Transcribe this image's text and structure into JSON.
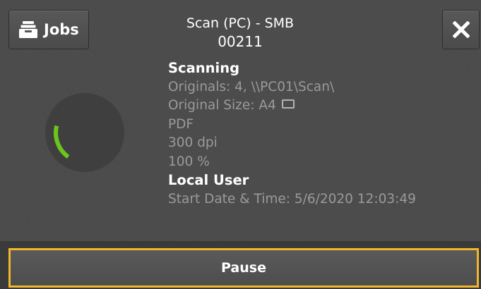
{
  "header": {
    "jobs_label": "Jobs",
    "title": "Scan (PC) - SMB",
    "job_number": "00211"
  },
  "status": {
    "state": "Scanning",
    "originals": "Originals: 4, \\\\PC01\\Scan\\",
    "original_size": "Original Size: A4",
    "file_format": "PDF",
    "resolution": "300 dpi",
    "scale": "100 %",
    "user": "Local User",
    "start_datetime": "Start Date & Time: 5/6/2020 12:03:49"
  },
  "footer": {
    "pause_label": "Pause"
  },
  "icons": {
    "jobs": "jobs-tray-icon",
    "close": "close-icon",
    "orientation": "landscape-orientation-icon"
  },
  "colors": {
    "progress_arc": "#6cc51c",
    "focus_border": "#f3b62a",
    "secondary_text": "#9a9a9a"
  }
}
